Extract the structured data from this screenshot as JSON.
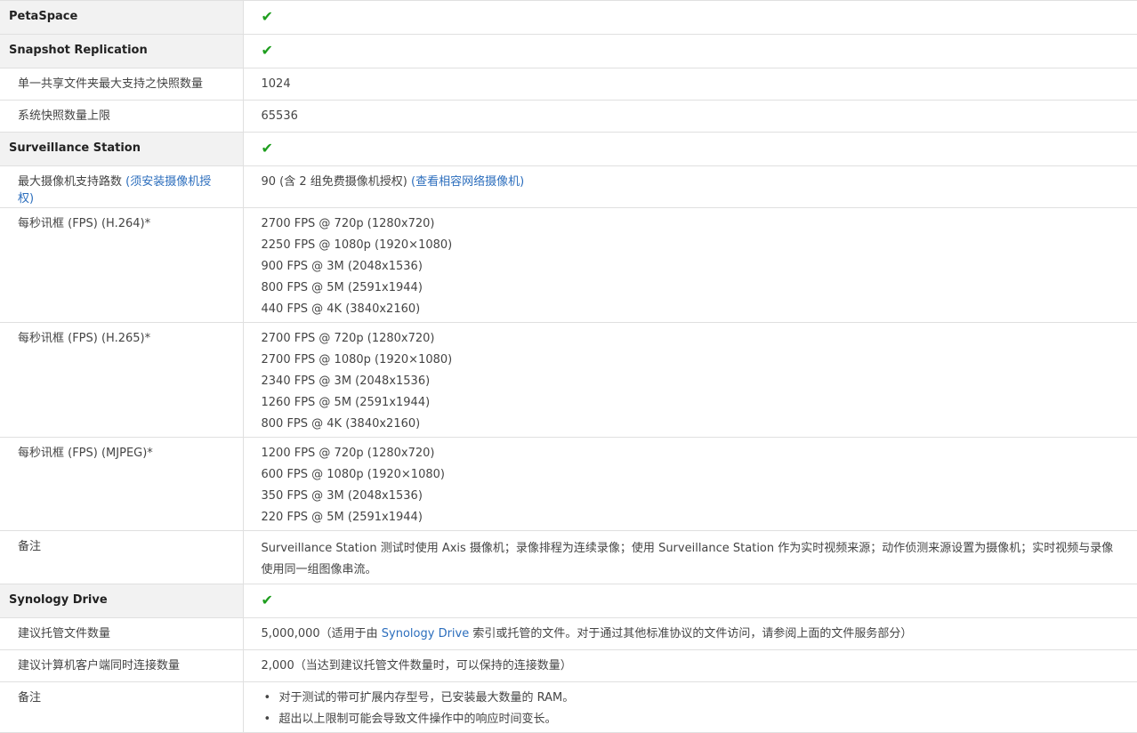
{
  "colors": {
    "check": "#1e9e1e",
    "link": "#2c6ebd",
    "section_bg": "#f2f2f2",
    "border": "#e0e0e0"
  },
  "icons": {
    "check": "checkmark-icon"
  },
  "petaspace": {
    "label": "PetaSpace"
  },
  "snapshot": {
    "label": "Snapshot Replication",
    "max_per_share_label": "单一共享文件夹最大支持之快照数量",
    "max_per_share_value": "1024",
    "system_max_label": "系统快照数量上限",
    "system_max_value": "65536"
  },
  "surveillance": {
    "label": "Surveillance Station",
    "max_cameras_label": "最大摄像机支持路数",
    "max_cameras_link": "(须安装摄像机授权)",
    "max_cameras_value": "90 (含 2 组免费摄像机授权)",
    "max_cameras_value_link": "(查看相容网络摄像机)",
    "fps_h264_label": "每秒讯框 (FPS) (H.264)*",
    "fps_h264": [
      "2700 FPS @ 720p (1280x720)",
      "2250 FPS @ 1080p (1920×1080)",
      "900 FPS @ 3M (2048x1536)",
      "800 FPS @ 5M (2591x1944)",
      "440 FPS @ 4K (3840x2160)"
    ],
    "fps_h265_label": "每秒讯框 (FPS) (H.265)*",
    "fps_h265": [
      "2700 FPS @ 720p (1280x720)",
      "2700 FPS @ 1080p (1920×1080)",
      "2340 FPS @ 3M (2048x1536)",
      "1260 FPS @ 5M (2591x1944)",
      "800 FPS @ 4K (3840x2160)"
    ],
    "fps_mjpeg_label": "每秒讯框 (FPS) (MJPEG)*",
    "fps_mjpeg": [
      "1200 FPS @ 720p (1280x720)",
      "600 FPS @ 1080p (1920×1080)",
      "350 FPS @ 3M (2048x1536)",
      "220 FPS @ 5M (2591x1944)"
    ],
    "notes_label": "备注",
    "notes_text": "Surveillance Station 测试时使用 Axis 摄像机；录像排程为连续录像；使用 Surveillance Station 作为实时视频来源；动作侦测来源设置为摄像机；实时视频与录像使用同一组图像串流。"
  },
  "drive": {
    "label": "Synology Drive",
    "files_label": "建议托管文件数量",
    "files_value_prefix": "5,000,000（适用于由 ",
    "files_value_link": "Synology Drive",
    "files_value_suffix": " 索引或托管的文件。对于通过其他标准协议的文件访问，请参阅上面的文件服务部分）",
    "clients_label": "建议计算机客户端同时连接数量",
    "clients_value": "2,000（当达到建议托管文件数量时，可以保持的连接数量）",
    "notes_label": "备注",
    "notes": [
      "对于测试的带可扩展内存型号，已安装最大数量的 RAM。",
      "超出以上限制可能会导致文件操作中的响应时间变长。"
    ]
  }
}
